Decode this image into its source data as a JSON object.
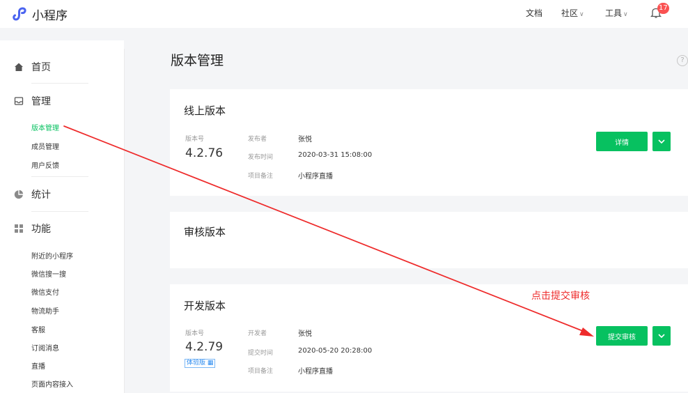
{
  "header": {
    "app_name": "小程序",
    "nav": [
      "文档",
      "社区",
      "工具"
    ],
    "notification_count": "17",
    "accent": "#07c160"
  },
  "sidebar": {
    "home": "首页",
    "manage": "管理",
    "manage_items": [
      "版本管理",
      "成员管理",
      "用户反馈"
    ],
    "stats": "统计",
    "features": "功能",
    "feature_items": [
      "附近的小程序",
      "微信搜一搜",
      "微信支付",
      "物流助手",
      "客服",
      "订阅消息",
      "直播",
      "页面内容接入"
    ]
  },
  "main": {
    "title": "版本管理",
    "help_icon": "question-circle-icon",
    "online": {
      "title": "线上版本",
      "version_label": "版本号",
      "version": "4.2.76",
      "publisher_label": "发布者",
      "publisher": "张悦",
      "time_label": "发布时间",
      "time": "2020-03-31 15:08:00",
      "note_label": "项目备注",
      "note": "小程序直播",
      "button": "详情"
    },
    "review": {
      "title": "审核版本"
    },
    "dev": {
      "title": "开发版本",
      "version_label": "版本号",
      "version": "4.2.79",
      "tag": "体验版",
      "developer_label": "开发者",
      "developer": "张悦",
      "time_label": "提交时间",
      "time": "2020-05-20 20:28:00",
      "note_label": "项目备注",
      "note": "小程序直播",
      "button": "提交审核"
    }
  },
  "annotation": {
    "text": "点击提交审核",
    "color": "#ee2b2b"
  }
}
